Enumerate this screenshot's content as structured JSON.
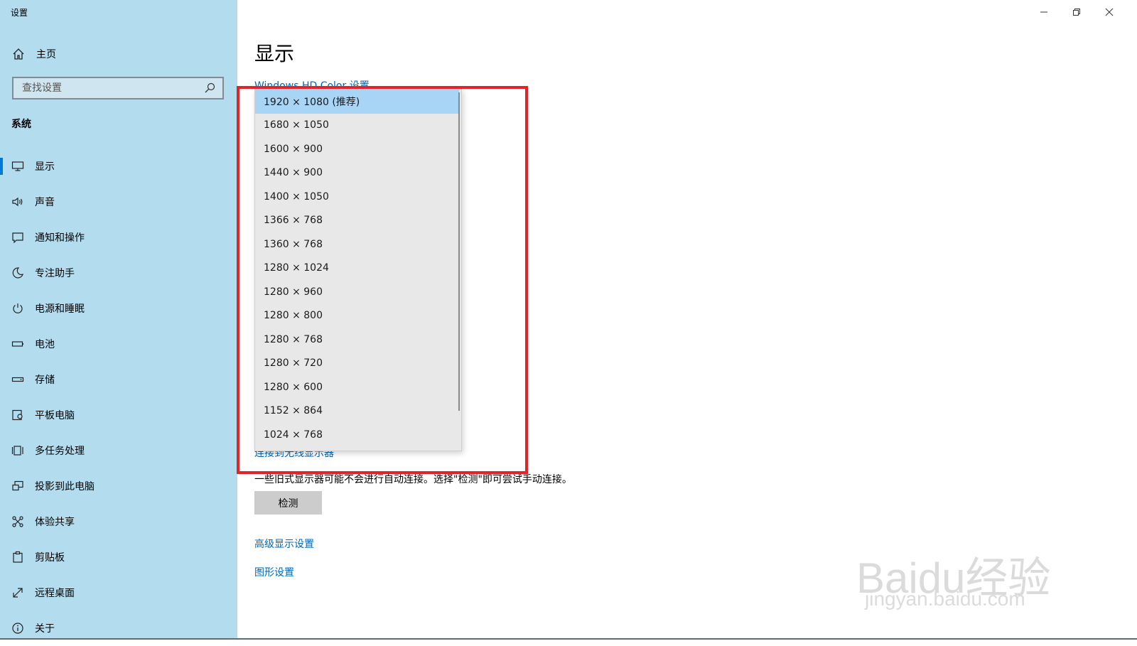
{
  "window": {
    "title": "设置",
    "controls": [
      "minimize-icon",
      "restore-icon",
      "close-icon"
    ]
  },
  "sidebar": {
    "home_label": "主页",
    "search_placeholder": "查找设置",
    "section_label": "系统",
    "items": [
      {
        "label": "显示",
        "icon": "monitor-icon",
        "active": true
      },
      {
        "label": "声音",
        "icon": "speaker-icon"
      },
      {
        "label": "通知和操作",
        "icon": "notification-icon"
      },
      {
        "label": "专注助手",
        "icon": "moon-icon"
      },
      {
        "label": "电源和睡眠",
        "icon": "power-icon"
      },
      {
        "label": "电池",
        "icon": "battery-icon"
      },
      {
        "label": "存储",
        "icon": "storage-icon"
      },
      {
        "label": "平板电脑",
        "icon": "tablet-icon"
      },
      {
        "label": "多任务处理",
        "icon": "multitask-icon"
      },
      {
        "label": "投影到此电脑",
        "icon": "project-icon"
      },
      {
        "label": "体验共享",
        "icon": "share-icon"
      },
      {
        "label": "剪贴板",
        "icon": "clipboard-icon"
      },
      {
        "label": "远程桌面",
        "icon": "remote-icon"
      },
      {
        "label": "关于",
        "icon": "info-icon"
      }
    ]
  },
  "main": {
    "title": "显示",
    "hdr_link": "Windows HD Color 设置",
    "connect_link": "连接到无线显示器",
    "hint": "一些旧式显示器可能不会进行自动连接。选择\"检测\"即可尝试手动连接。",
    "detect_button": "检测",
    "advanced_link": "高级显示设置",
    "graphics_link": "图形设置"
  },
  "dropdown": {
    "selected_index": 0,
    "options": [
      "1920 × 1080 (推荐)",
      "1680 × 1050",
      "1600 × 900",
      "1440 × 900",
      "1400 × 1050",
      "1366 × 768",
      "1360 × 768",
      "1280 × 1024",
      "1280 × 960",
      "1280 × 800",
      "1280 × 768",
      "1280 × 720",
      "1280 × 600",
      "1152 × 864",
      "1024 × 768"
    ]
  },
  "watermark": {
    "brand": "Baidu经验",
    "url": "jingyan.baidu.com"
  },
  "colors": {
    "sidebar_bg": "#b3dcef",
    "accent": "#0078d7",
    "link": "#0067b8",
    "highlight_border": "#e3232a",
    "selected_option": "#a8d4f6"
  }
}
